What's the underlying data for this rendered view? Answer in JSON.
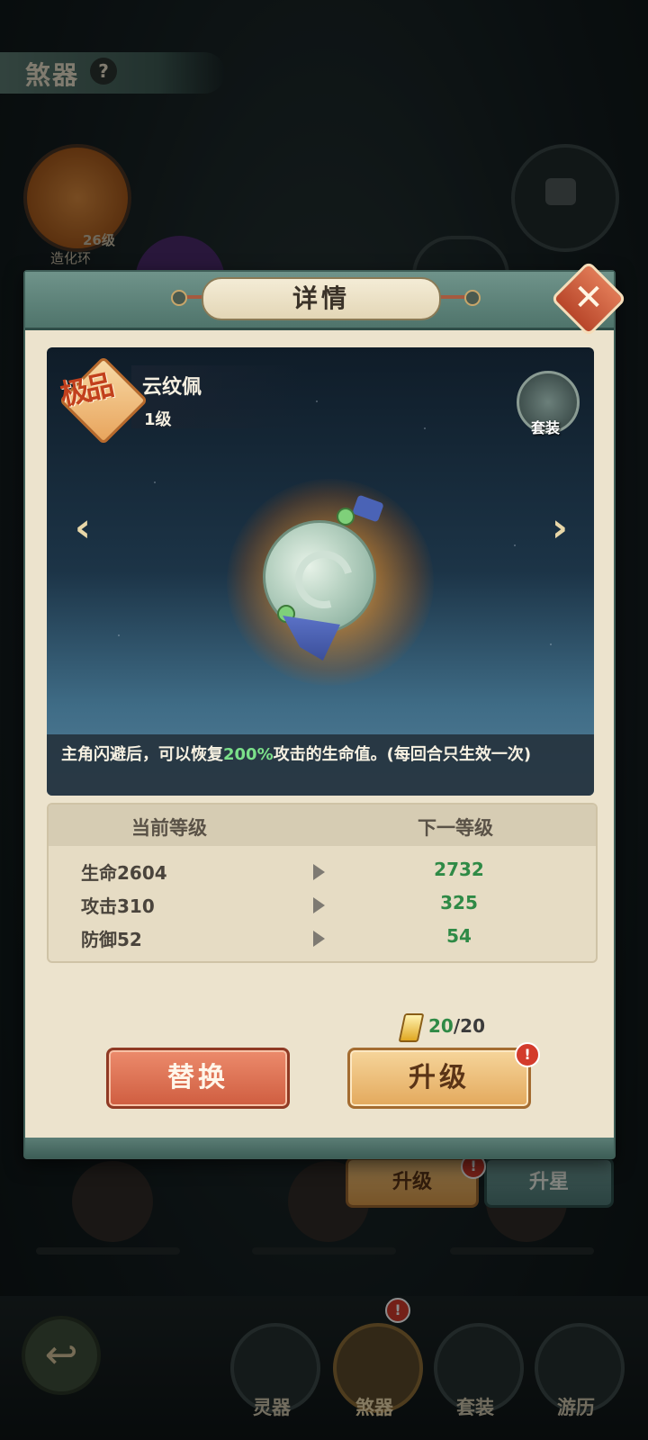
{
  "background": {
    "section_title": "煞器",
    "help_icon": "?",
    "node": {
      "name": "造化环",
      "level": "26级"
    },
    "bottom_buttons": {
      "upgrade": "升级",
      "star_up": "升星",
      "badge": "!"
    },
    "nav": {
      "tabs": [
        {
          "label": "灵器",
          "icon": "sword-icon"
        },
        {
          "label": "煞器",
          "icon": "fang-icon"
        },
        {
          "label": "套装",
          "icon": "scroll-icon"
        },
        {
          "label": "游历",
          "icon": "mountain-icon"
        }
      ],
      "badge": "!",
      "back_icon": "↩"
    }
  },
  "modal": {
    "title": "详情",
    "close_icon": "✕",
    "item": {
      "rarity": "极品",
      "name": "云纹佩",
      "level": "1级",
      "set_label": "套装",
      "prev_arrow": "‹",
      "next_arrow": "›",
      "description_prefix": "主角闪避后，可以恢复",
      "description_highlight": "200%",
      "description_suffix": "攻击的生命值。(每回合只生效一次)"
    },
    "stats": {
      "current_header": "当前等级",
      "next_header": "下一等级",
      "rows": [
        {
          "current": "生命2604",
          "next": "2732"
        },
        {
          "current": "攻击310",
          "next": "325"
        },
        {
          "current": "防御52",
          "next": "54"
        }
      ]
    },
    "cost": {
      "have": "20",
      "sep": "/",
      "need": "20"
    },
    "buttons": {
      "replace": "替换",
      "upgrade": "升级",
      "badge": "!"
    }
  },
  "colors": {
    "highlight_green": "#7be08a",
    "next_value_green": "#2f8a46",
    "replace_button": "#cf5d40",
    "upgrade_button": "#e3a95d",
    "badge_red": "#d33b2c"
  }
}
